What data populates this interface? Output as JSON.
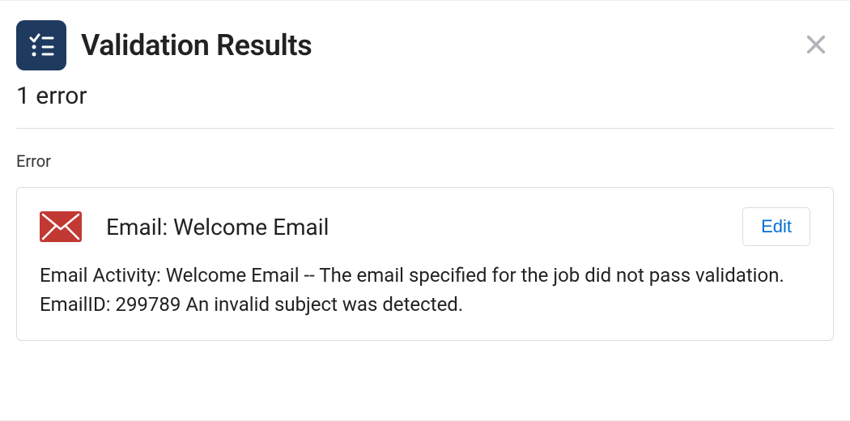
{
  "header": {
    "title": "Validation Results"
  },
  "summary": {
    "error_count_text": "1 error"
  },
  "section": {
    "label": "Error"
  },
  "errors": [
    {
      "title": "Email: Welcome Email",
      "edit_label": "Edit",
      "message": "Email Activity: Welcome Email -- The email specified for the job did not pass validation. EmailID: 299789 An invalid subject was detected."
    }
  ]
}
